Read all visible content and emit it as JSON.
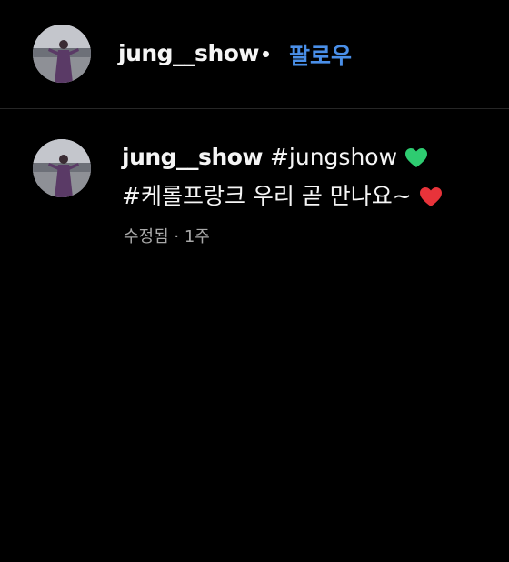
{
  "header": {
    "username": "jung__show",
    "separator": "•",
    "follow_label": "팔로우"
  },
  "comment": {
    "username": "jung__show",
    "hashtag1": "#jungshow",
    "hashtag2": "#케롤프랑크",
    "text": "우리 곧 만나요~",
    "meta": "수정됨 · 1주",
    "emoji1": "green-heart-icon",
    "emoji2": "red-heart-icon"
  },
  "colors": {
    "background": "#000000",
    "text": "#f5f5f5",
    "link": "#4a8fe8",
    "muted": "#a8a8a8",
    "green_heart": "#2ecc71",
    "red_heart": "#e8333a"
  }
}
